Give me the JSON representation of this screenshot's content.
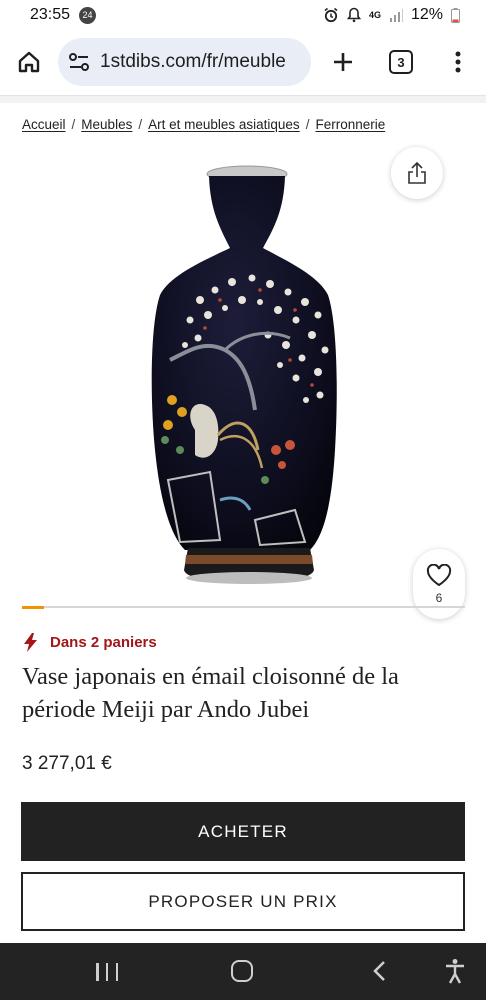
{
  "status_bar": {
    "time": "23:55",
    "notification_count": "24",
    "network": "4G",
    "battery": "12%"
  },
  "browser": {
    "url": "1stdibs.com/fr/meuble",
    "tab_count": "3",
    "icons": {
      "home": "home-icon",
      "site_settings": "tune-icon",
      "new_tab": "plus-icon",
      "menu": "more-vert-icon"
    }
  },
  "breadcrumb": [
    {
      "label": "Accueil"
    },
    {
      "label": "Meubles"
    },
    {
      "label": "Art et meubles asiatiques"
    },
    {
      "label": "Ferronnerie"
    }
  ],
  "breadcrumb_separator": "/",
  "product": {
    "favorites_count": "6",
    "basket_notice": "Dans 2 paniers",
    "title": "Vase japonais en émail cloisonné de la période Meiji par Ando Jubei",
    "price": "3 277,01 €",
    "buy_label": "ACHETER",
    "offer_label": "PROPOSER UN PRIX",
    "carousel_progress": 0.05
  },
  "colors": {
    "accent_orange": "#f39200",
    "alert_red": "#a3161a",
    "button_dark": "#222222",
    "url_bar_bg": "#e9eef6"
  }
}
